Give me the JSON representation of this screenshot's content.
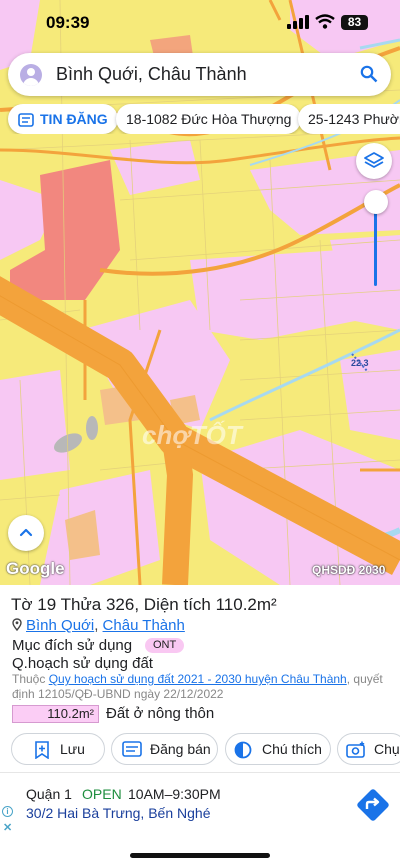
{
  "status_bar": {
    "time": "09:39",
    "battery": "83"
  },
  "search": {
    "query": "Bình Quới, Châu Thành"
  },
  "chips": [
    {
      "label": "TIN ĐĂNG"
    },
    {
      "label": "18-1082 Đức Hòa Thượng"
    },
    {
      "label": "25-1243 Phườn"
    }
  ],
  "map": {
    "road_label": "22.3",
    "watermark": "chợTỐT",
    "attribution": "Google",
    "overlay_label": "QHSDĐ 2030",
    "colors": {
      "residential_yellow": "#f6ea7a",
      "rural_pink": "#f7c8f3",
      "road_orange": "#f3a33c",
      "urban_red": "#f2877f",
      "water": "#a7d9f0"
    }
  },
  "parcel": {
    "title": "Tờ 19 Thửa 326, Diện tích 110.2m²",
    "commune": "Bình Quới",
    "separator": ",",
    "district": "Châu Thành",
    "purpose_label": "Mục đích sử dụng",
    "purpose_code": "ONT",
    "plan_heading": "Q.hoạch sử dụng đất",
    "plan_prefix": "Thuộc",
    "plan_link": "Quy hoạch sử dụng đất 2021 - 2030 huyện Châu Thành",
    "plan_decision": ", quyết định 12105/QĐ-UBND ngày 22/12/2022",
    "area_value": "110.2m²",
    "area_label": "Đất ở nông thôn"
  },
  "actions": [
    {
      "label": "Lưu"
    },
    {
      "label": "Đăng bán"
    },
    {
      "label": "Chú thích"
    },
    {
      "label": "Chụ"
    }
  ],
  "ad": {
    "name": "Quận 1",
    "status": "OPEN",
    "hours": "10AM–9:30PM",
    "address": "30/2 Hai Bà Trưng, Bến Nghé"
  }
}
